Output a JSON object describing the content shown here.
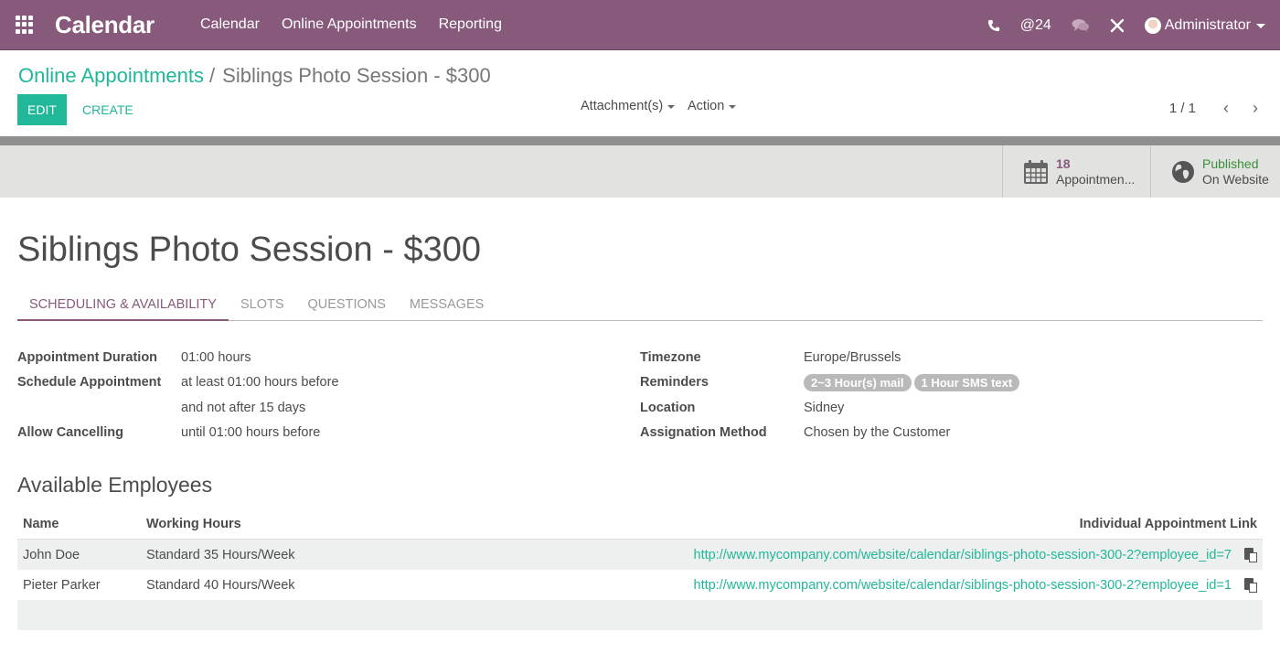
{
  "navbar": {
    "app_title": "Calendar",
    "menu": [
      "Calendar",
      "Online Appointments",
      "Reporting"
    ],
    "mentions_count": "@24",
    "user": "Administrator",
    "color": "#875A7B"
  },
  "control_panel": {
    "breadcrumb": {
      "parent": "Online Appointments",
      "separator": "/",
      "current": "Siblings Photo Session - $300"
    },
    "edit_label": "EDIT",
    "create_label": "CREATE",
    "attachments_label": "Attachment(s)",
    "action_label": "Action",
    "pager": "1 / 1",
    "prev_icon": "‹",
    "next_icon": "›"
  },
  "button_box": {
    "appointments": {
      "count": "18",
      "label": "Appointmen..."
    },
    "website": {
      "status": "Published",
      "label": "On Website"
    }
  },
  "record": {
    "title": "Siblings Photo Session - $300",
    "tabs": [
      "SCHEDULING & AVAILABILITY",
      "SLOTS",
      "QUESTIONS",
      "MESSAGES"
    ],
    "active_tab": "SCHEDULING & AVAILABILITY",
    "left_fields": [
      {
        "label": "Appointment Duration",
        "value": "01:00 hours"
      },
      {
        "label": "Schedule Appointment",
        "value": "at least 01:00 hours before"
      },
      {
        "label": "",
        "value": "and not after 15 days"
      },
      {
        "label": "Allow Cancelling",
        "value": "until 01:00 hours before"
      }
    ],
    "right_fields": {
      "timezone": {
        "label": "Timezone",
        "value": "Europe/Brussels"
      },
      "reminders": {
        "label": "Reminders",
        "tags": [
          "2~3 Hour(s) mail",
          "1 Hour SMS text"
        ]
      },
      "location": {
        "label": "Location",
        "value": "Sidney"
      },
      "assignation": {
        "label": "Assignation Method",
        "value": "Chosen by the Customer"
      }
    }
  },
  "employees": {
    "section_title": "Available Employees",
    "columns": [
      "Name",
      "Working Hours",
      "Individual Appointment Link"
    ],
    "rows": [
      {
        "name": "John Doe",
        "hours": "Standard 35 Hours/Week",
        "link": "http://www.mycompany.com/website/calendar/siblings-photo-session-300-2?employee_id=7"
      },
      {
        "name": "Pieter Parker",
        "hours": "Standard 40 Hours/Week",
        "link": "http://www.mycompany.com/website/calendar/siblings-photo-session-300-2?employee_id=1"
      }
    ]
  }
}
